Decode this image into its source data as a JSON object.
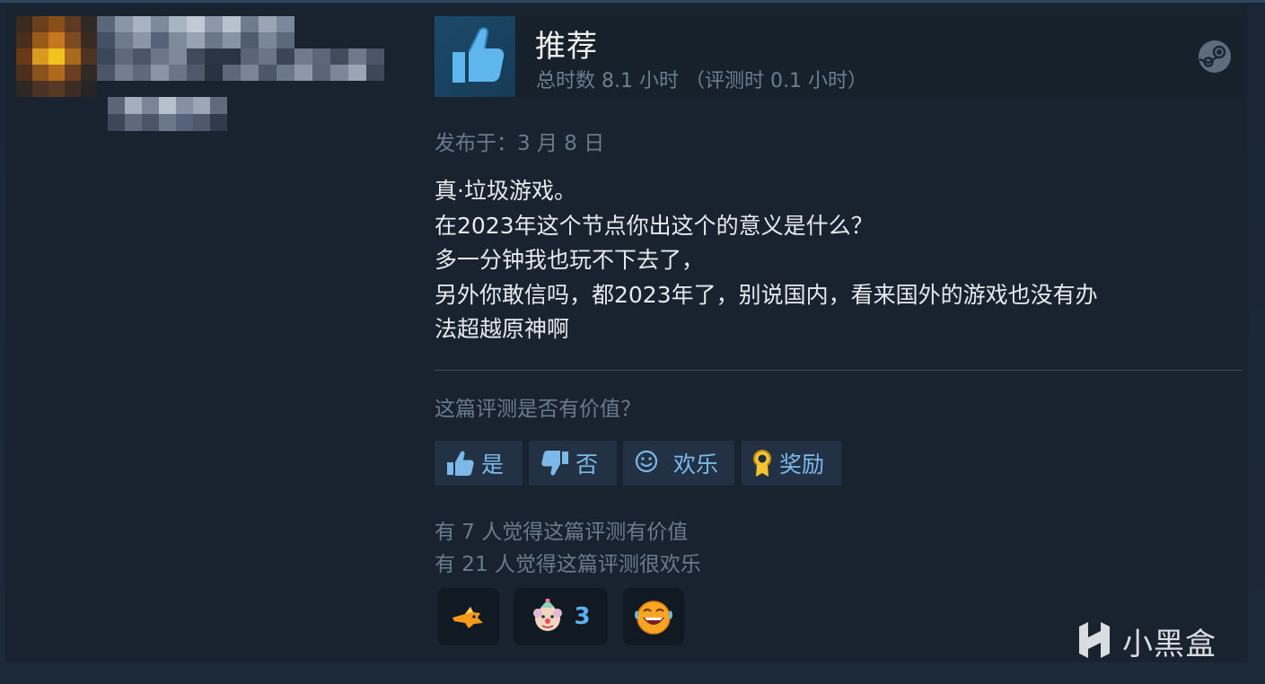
{
  "review": {
    "verdict": "推荐",
    "hours": "总时数 8.1 小时 （评测时 0.1 小时）",
    "posted": "发布于：3 月 8 日",
    "text_lines": [
      "真·垃圾游戏。",
      "在2023年这个节点你出这个的意义是什么？",
      "多一分钟我也玩不下去了，",
      "另外你敢信吗，都2023年了，别说国内，看来国外的游戏也没有办",
      "法超越原神啊"
    ]
  },
  "feedback": {
    "question": "这篇评测是否有价值？",
    "buttons": {
      "yes": "是",
      "no": "否",
      "funny": "欢乐",
      "award": "奖励"
    },
    "helpful_count_text": "有 7 人觉得这篇评测有价值",
    "funny_count_text": "有 21 人觉得这篇评测很欢乐"
  },
  "awards": [
    {
      "icon": "fox-award-icon",
      "count": ""
    },
    {
      "icon": "clown-award-icon",
      "count": "3"
    },
    {
      "icon": "laughing-face-award-icon",
      "count": ""
    }
  ],
  "watermark": {
    "text": "小黑盒"
  },
  "colors": {
    "background": "#1d2a38",
    "card": "#18232f",
    "accent_blue": "#7db9e8",
    "muted_text": "#6a7b8c",
    "body_text": "#e6eaee"
  }
}
